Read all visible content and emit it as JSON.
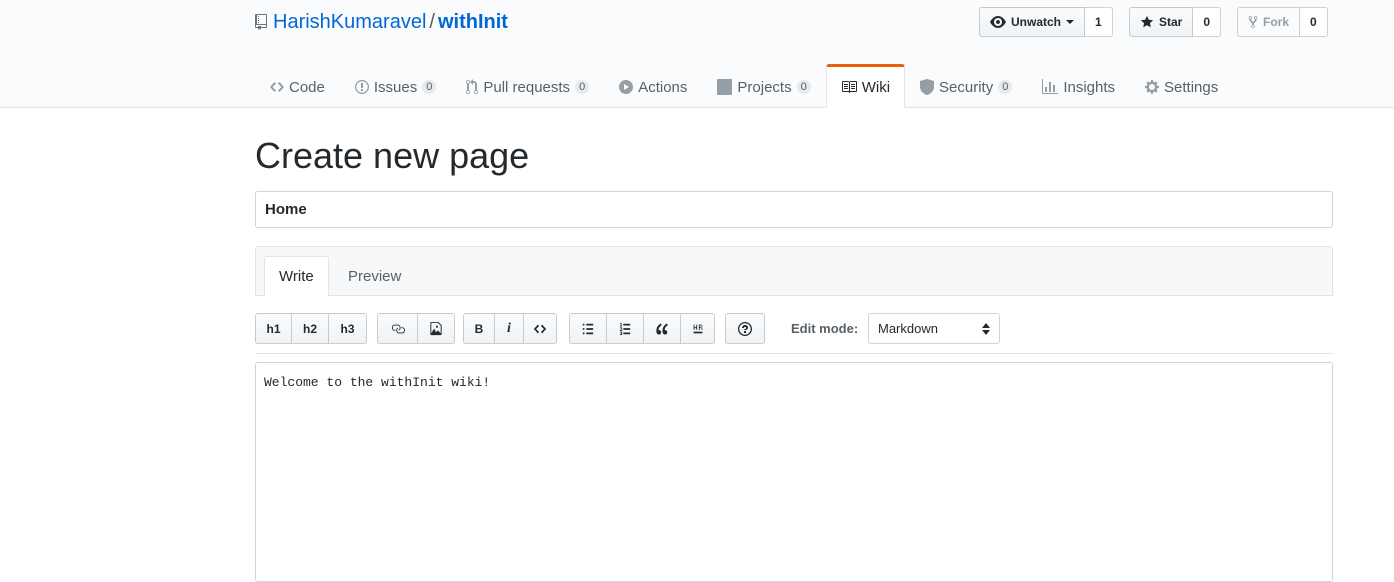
{
  "repo": {
    "owner": "HarishKumaravel",
    "separator": "/",
    "name": "withInit"
  },
  "actions": {
    "watch": {
      "label": "Unwatch",
      "count": "1"
    },
    "star": {
      "label": "Star",
      "count": "0"
    },
    "fork": {
      "label": "Fork",
      "count": "0"
    }
  },
  "nav": [
    {
      "label": "Code",
      "icon": "code-icon"
    },
    {
      "label": "Issues",
      "count": "0",
      "icon": "issue-icon"
    },
    {
      "label": "Pull requests",
      "count": "0",
      "icon": "pull-request-icon"
    },
    {
      "label": "Actions",
      "icon": "play-icon"
    },
    {
      "label": "Projects",
      "count": "0",
      "icon": "project-icon"
    },
    {
      "label": "Wiki",
      "icon": "book-icon",
      "selected": true
    },
    {
      "label": "Security",
      "count": "0",
      "icon": "shield-icon"
    },
    {
      "label": "Insights",
      "icon": "graph-icon"
    },
    {
      "label": "Settings",
      "icon": "gear-icon"
    }
  ],
  "page": {
    "title": "Create new page",
    "page_title_value": "Home"
  },
  "tabs": {
    "write": "Write",
    "preview": "Preview"
  },
  "toolbar": {
    "h1": "h1",
    "h2": "h2",
    "h3": "h3",
    "bold": "B",
    "italic": "i",
    "edit_mode_label": "Edit mode:",
    "edit_mode_value": "Markdown"
  },
  "editor": {
    "content": "Welcome to the withInit wiki!"
  },
  "colors": {
    "link": "#0366d6",
    "selected_tab_accent": "#e36209",
    "header_bg": "#fafbfc"
  }
}
